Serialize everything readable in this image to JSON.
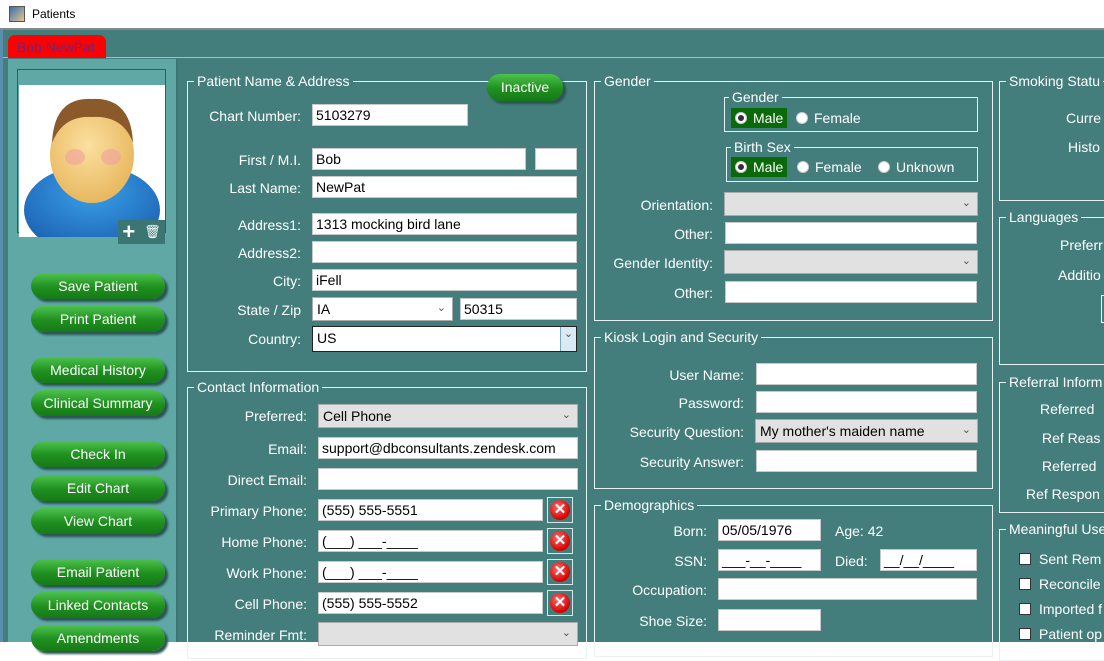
{
  "window": {
    "title": "Patients"
  },
  "tab": {
    "label": "Bob NewPat"
  },
  "sidebar": {
    "buttons": [
      {
        "label": "Save Patient"
      },
      {
        "label": "Print Patient"
      },
      {
        "label": "Medical History"
      },
      {
        "label": "Clinical Summary"
      },
      {
        "label": "Check In"
      },
      {
        "label": "Edit Chart"
      },
      {
        "label": "View Chart"
      },
      {
        "label": "Email Patient"
      },
      {
        "label": "Linked Contacts"
      },
      {
        "label": "Amendments"
      }
    ],
    "photo_add": "+",
    "photo_delete": "🗑"
  },
  "name_address": {
    "legend": "Patient Name & Address",
    "chart_number_label": "Chart Number:",
    "chart_number": "5103279",
    "inactive_label": "Inactive",
    "first_mi_label": "First / M.I.",
    "first": "Bob",
    "mi": "",
    "last_label": "Last Name:",
    "last": "NewPat",
    "address1_label": "Address1:",
    "address1": "1313 mocking bird lane",
    "address2_label": "Address2:",
    "address2": "",
    "city_label": "City:",
    "city": "iFell",
    "state_zip_label": "State / Zip",
    "state": "IA",
    "zip": "50315",
    "country_label": "Country:",
    "country": "US"
  },
  "contact": {
    "legend": "Contact Information",
    "preferred_label": "Preferred:",
    "preferred": "Cell Phone",
    "email_label": "Email:",
    "email": "support@dbconsultants.zendesk.com",
    "direct_email_label": "Direct Email:",
    "direct_email": "",
    "primary_phone_label": "Primary Phone:",
    "primary_phone": "(555) 555-5551",
    "home_phone_label": "Home Phone:",
    "home_phone": "(___) ___-____",
    "work_phone_label": "Work Phone:",
    "work_phone": "(___) ___-____",
    "cell_phone_label": "Cell Phone:",
    "cell_phone": "(555) 555-5552",
    "reminder_label": "Reminder Fmt:",
    "reminder": "",
    "clear_glyph": "✕"
  },
  "gender": {
    "legend": "Gender",
    "gender_legend": "Gender",
    "gender_options": [
      "Male",
      "Female"
    ],
    "gender_selected": "Male",
    "birth_sex_legend": "Birth Sex",
    "birth_sex_options": [
      "Male",
      "Female",
      "Unknown"
    ],
    "birth_sex_selected": "Male",
    "orientation_label": "Orientation:",
    "orientation": "",
    "other1_label": "Other:",
    "other1": "",
    "identity_label": "Gender Identity:",
    "identity": "",
    "other2_label": "Other:",
    "other2": ""
  },
  "kiosk": {
    "legend": "Kiosk Login and Security",
    "username_label": "User Name:",
    "username": "",
    "password_label": "Password:",
    "password": "",
    "question_label": "Security Question:",
    "question": "My mother's maiden name",
    "answer_label": "Security Answer:",
    "answer": ""
  },
  "demographics": {
    "legend": "Demographics",
    "born_label": "Born:",
    "born": "05/05/1976",
    "age_text": "Age: 42",
    "ssn_label": "SSN:",
    "ssn": "___-__-____",
    "died_label": "Died:",
    "died": "__/__/____",
    "occupation_label": "Occupation:",
    "occupation": "",
    "shoe_label": "Shoe Size:",
    "shoe": ""
  },
  "smoking": {
    "legend": "Smoking Statu",
    "current_label": "Curre",
    "history_label": "Histo"
  },
  "languages": {
    "legend": "Languages",
    "preferred_label": "Preferr",
    "additional_label": "Additio"
  },
  "referral": {
    "legend": "Referral Inform",
    "referred_label": "Referred",
    "reason_label": "Ref Reas",
    "referred_to_label": "Referred",
    "response_label": "Ref Respon"
  },
  "meaningful_use": {
    "legend": "Meaningful Use",
    "items": [
      {
        "label": "Sent Rem",
        "checked": false
      },
      {
        "label": "Reconcile",
        "checked": false
      },
      {
        "label": "Imported f",
        "checked": false
      },
      {
        "label": "Patient op",
        "checked": false
      }
    ]
  },
  "chevron": "⌄"
}
